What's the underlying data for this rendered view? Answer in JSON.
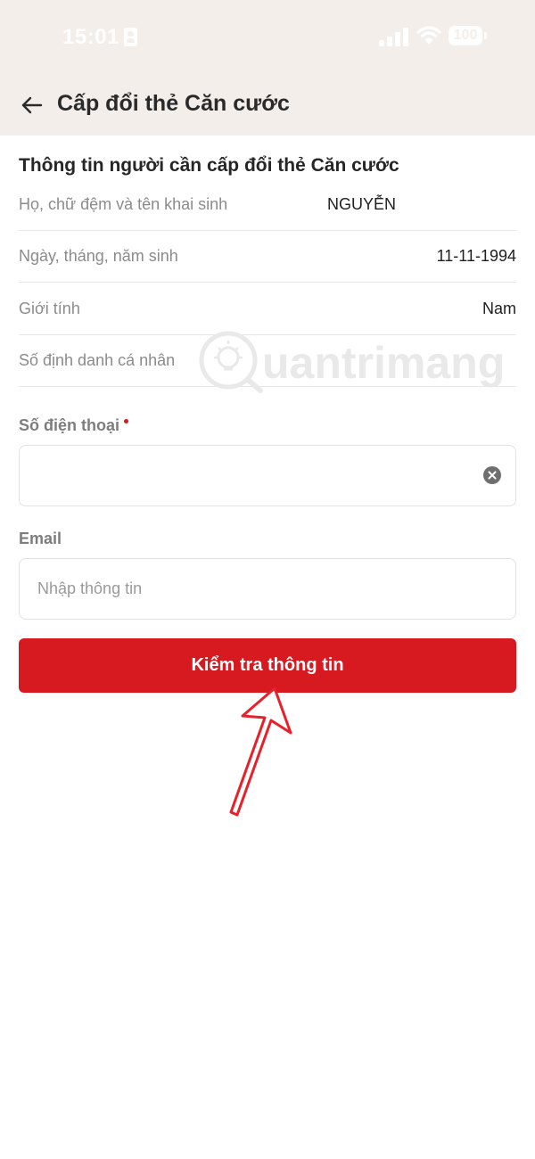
{
  "status_bar": {
    "time": "15:01",
    "battery": "100",
    "icons": [
      "id-card-icon",
      "signal-icon",
      "wifi-icon",
      "battery-icon"
    ]
  },
  "header": {
    "title": "Cấp đổi thẻ Căn cước",
    "back_icon": "arrow-left-icon"
  },
  "personal_info": {
    "section_title": "Thông tin người cần cấp đổi thẻ Căn cước",
    "rows": [
      {
        "label": "Họ, chữ đệm và tên khai sinh",
        "value": "NGUYỄN"
      },
      {
        "label": "Ngày, tháng, năm sinh",
        "value": "11-11-1994"
      },
      {
        "label": "Giới tính",
        "value": "Nam"
      },
      {
        "label": "Số định danh cá nhân",
        "value": ""
      }
    ]
  },
  "form": {
    "phone": {
      "label": "Số điện thoại",
      "required": true,
      "value": "",
      "placeholder": ""
    },
    "email": {
      "label": "Email",
      "value": "",
      "placeholder": "Nhập thông tin"
    },
    "submit_label": "Kiểm tra thông tin"
  },
  "watermark": {
    "text": "uantrimang"
  },
  "colors": {
    "accent": "#d71920",
    "header_bg": "#f3eeea",
    "annotation": "#e8202a"
  }
}
